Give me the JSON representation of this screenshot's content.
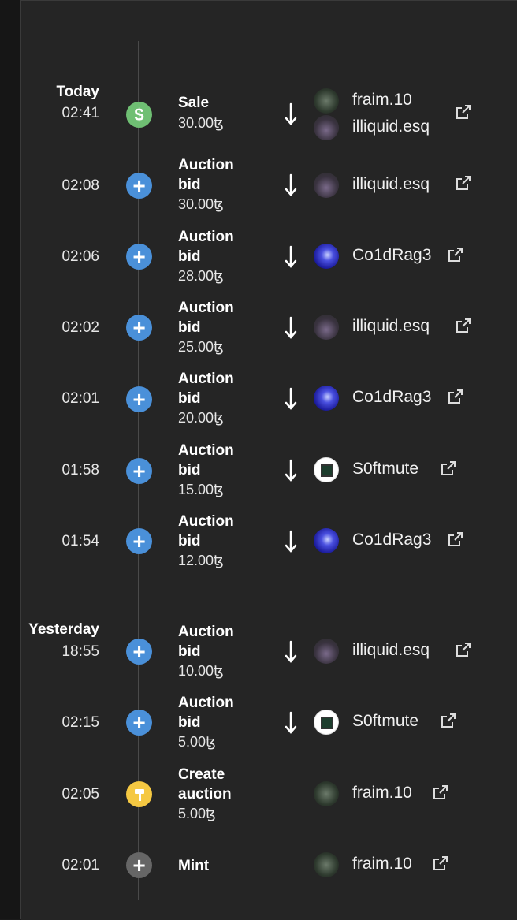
{
  "sections": [
    {
      "label": "Today"
    },
    {
      "label": "Yesterday"
    }
  ],
  "events": [
    {
      "time": "02:41",
      "type": "sale",
      "label": "Sale",
      "amount": "30.00ꜩ",
      "from": "fraim.10",
      "to": "illiquid.esq"
    },
    {
      "time": "02:08",
      "type": "bid",
      "label": "Auction\nbid",
      "amount": "30.00ꜩ",
      "user": "illiquid.esq"
    },
    {
      "time": "02:06",
      "type": "bid",
      "label": "Auction\nbid",
      "amount": "28.00ꜩ",
      "user": "Co1dRag3"
    },
    {
      "time": "02:02",
      "type": "bid",
      "label": "Auction\nbid",
      "amount": "25.00ꜩ",
      "user": "illiquid.esq"
    },
    {
      "time": "02:01",
      "type": "bid",
      "label": "Auction\nbid",
      "amount": "20.00ꜩ",
      "user": "Co1dRag3"
    },
    {
      "time": "01:58",
      "type": "bid",
      "label": "Auction\nbid",
      "amount": "15.00ꜩ",
      "user": "S0ftmute"
    },
    {
      "time": "01:54",
      "type": "bid",
      "label": "Auction\nbid",
      "amount": "12.00ꜩ",
      "user": "Co1dRag3"
    },
    {
      "time": "18:55",
      "type": "bid",
      "label": "Auction\nbid",
      "amount": "10.00ꜩ",
      "user": "illiquid.esq"
    },
    {
      "time": "02:15",
      "type": "bid",
      "label": "Auction\nbid",
      "amount": "5.00ꜩ",
      "user": "S0ftmute"
    },
    {
      "time": "02:05",
      "type": "create",
      "label": "Create\nauction",
      "amount": "5.00ꜩ",
      "user": "fraim.10"
    },
    {
      "time": "02:01",
      "type": "mint",
      "label": "Mint",
      "user": "fraim.10"
    }
  ],
  "icons": {
    "sale": "dollar-icon",
    "bid": "plus-icon",
    "create": "gavel-icon",
    "mint": "plus-icon",
    "transfer": "arrow-down-icon",
    "link": "external-link-icon"
  },
  "colors": {
    "sale": "#6fbf73",
    "bid": "#4a90d9",
    "create": "#f5c842",
    "mint": "#666666"
  }
}
